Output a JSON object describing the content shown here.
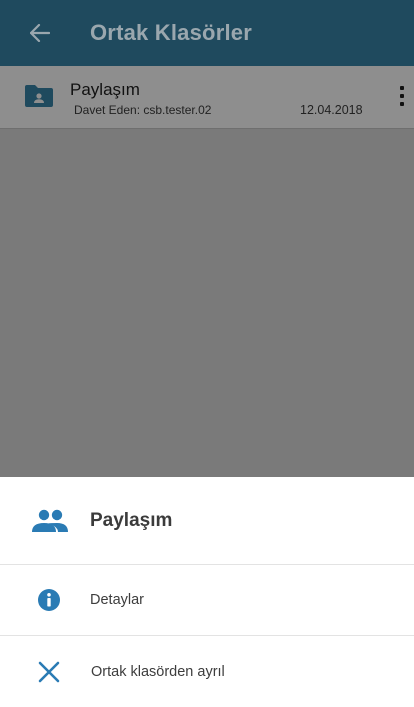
{
  "header": {
    "title": "Ortak Klasörler",
    "back_icon": "arrow-left-icon"
  },
  "shared_folder": {
    "name": "Paylaşım",
    "invited_by": "Davet Eden: csb.tester.02",
    "date": "12.04.2018",
    "icon": "folder-user-icon",
    "menu_icon": "more-vertical-icon"
  },
  "bottom_sheet": {
    "title": "Paylaşım",
    "title_icon": "people-icon",
    "items": [
      {
        "label": "Detaylar",
        "icon": "info-icon"
      },
      {
        "label": "Ortak klasörden ayrıl",
        "icon": "close-icon"
      }
    ]
  },
  "colors": {
    "appbar": "#1f4a5e",
    "accent": "#2a7bb4",
    "scrim": "#7a7a7a"
  }
}
